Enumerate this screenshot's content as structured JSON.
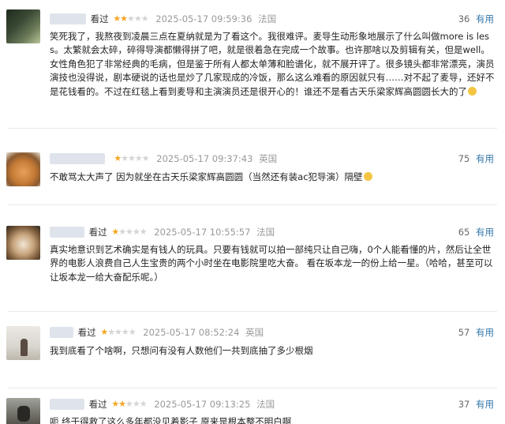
{
  "reviews": [
    {
      "user": "░░░░░░",
      "watched": "看过",
      "rating": 2,
      "date": "2025-05-17 09:59:36",
      "location": "法国",
      "votes": "36",
      "useful_label": "有用",
      "text": "笑死我了，我熬夜到凌晨三点在夏纳就是为了看这个。我很难评。麦导生动形象地展示了什么叫做more is less。太繁就会太碎，碎得导演都懒得拼了吧，就是很着急在完成一个故事。也许那啥以及剪辑有关，但是well。女性角色犯了非常经典的毛病，但是鉴于所有人都太单薄和脸谱化，就不展开评了。很多镜头都非常漂亮，演员演技也没得说，剧本硬说的话也是炒了几家现成的冷饭，那么这么难看的原因就只有……对不起了麦导，还好不是花钱看的。不过在红毯上看到麦导和主演演员还是很开心的！谁还不是看古天乐梁家辉高圆圆长大的了",
      "avatar": "dark-green-photo"
    },
    {
      "user": "░░░░░░",
      "watched": "",
      "rating": 1,
      "date": "2025-05-17 09:37:43",
      "location": "英国",
      "votes": "75",
      "useful_label": "有用",
      "text": "不敢骂太大声了 因为就坐在古天乐梁家辉高圆圆（当然还有装ac犯导演）隔壁",
      "avatar": "shiba-dog"
    },
    {
      "user": "░░░░░",
      "watched": "看过",
      "rating": 1,
      "date": "2025-05-17 10:55:57",
      "location": "法国",
      "votes": "65",
      "useful_label": "有用",
      "text": "真实地意识到艺术确实是有钱人的玩具。只要有钱就可以拍一部纯只让自己嗨，0个人能看懂的片，然后让全世界的电影人浪费自己人生宝贵的两个小时坐在电影院里吃大奋。 看在坂本龙一的份上给一星。（哈哈，甚至可以让坂本龙一给大奋配乐呢。）",
      "avatar": "pomeranian-dog"
    },
    {
      "user": "░░░░",
      "watched": "看过",
      "rating": 1,
      "date": "2025-05-17 08:52:24",
      "location": "英国",
      "votes": "57",
      "useful_label": "有用",
      "text": "我到底看了个啥啊，只想问有没有人数他们一共到底抽了多少根烟",
      "avatar": "person-on-wall"
    },
    {
      "user": "░░░░░",
      "watched": "看过",
      "rating": 2,
      "date": "2025-05-17 09:13:25",
      "location": "法国",
      "votes": "37",
      "useful_label": "有用",
      "text": "呃 终于得救了这么多年都没见着影子 原来是根本整不明白啊",
      "avatar": "person-sitting"
    }
  ],
  "colors": {
    "star_on": "#f5a623",
    "star_off": "#d4d4d4",
    "useful_link": "#3377aa",
    "meta_gray": "#999999"
  }
}
